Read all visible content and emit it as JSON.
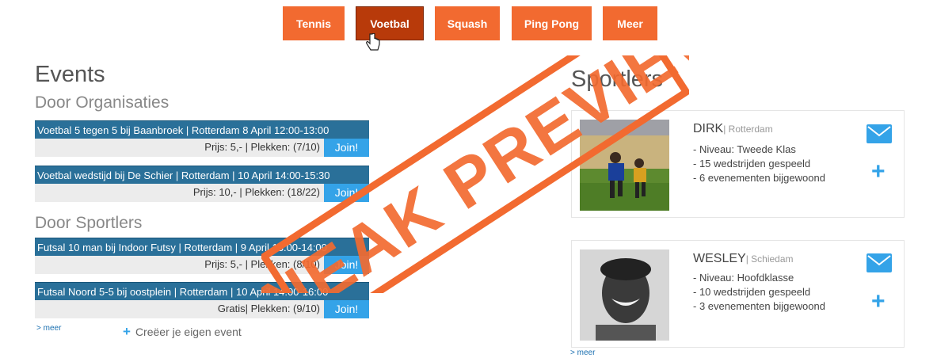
{
  "nav": {
    "tabs": [
      {
        "label": "Tennis",
        "active": false
      },
      {
        "label": "Voetbal",
        "active": true
      },
      {
        "label": "Squash",
        "active": false
      },
      {
        "label": "Ping Pong",
        "active": false
      },
      {
        "label": "Meer",
        "active": false
      }
    ]
  },
  "events": {
    "heading": "Events",
    "org_heading": "Door Organisaties",
    "sport_heading": "Door Sportlers",
    "join_label": "Join!",
    "org_items": [
      {
        "title": "Voetbal 5 tegen 5 bij Baanbroek | Rotterdam 8 April 12:00-13:00",
        "meta": "Prijs: 5,- | Plekken: (7/10)"
      },
      {
        "title": "Voetbal wedstijd bij De Schier | Rotterdam | 10 April 14:00-15:30",
        "meta": "Prijs: 10,- | Plekken: (18/22)"
      }
    ],
    "sport_items": [
      {
        "title": "Futsal 10 man bij Indoor Futsy | Rotterdam | 9 April 13:00-14:00",
        "meta": "Prijs: 5,- | Plekken: (8/10)"
      },
      {
        "title": "Futsal Noord 5-5 bij oostplein | Rotterdam | 10 April 14:00-16:00",
        "meta": "Gratis| Plekken: (9/10)"
      }
    ],
    "more_label": "> meer",
    "create_label": "Creëer je eigen event"
  },
  "sportlers": {
    "heading": "Sportlers",
    "more_label": "> meer",
    "cards": [
      {
        "name": "DIRK",
        "city": "| Rotterdam",
        "stats": [
          "- Niveau: Tweede Klas",
          "- 15 wedstrijden gespeeld",
          "- 6 evenementen bijgewoond"
        ]
      },
      {
        "name": "WESLEY",
        "city": "| Schiedam",
        "stats": [
          "- Niveau: Hoofdklasse",
          "- 10 wedstrijden gespeeld",
          "- 3 evenementen bijgewoond"
        ]
      }
    ]
  },
  "overlay": {
    "stamp_text": "SNEAK PREVIEW"
  },
  "colors": {
    "accent": "#f26a30",
    "accent_active": "#b83a0a",
    "event_bar": "#2a7099",
    "join": "#34a3e8"
  }
}
